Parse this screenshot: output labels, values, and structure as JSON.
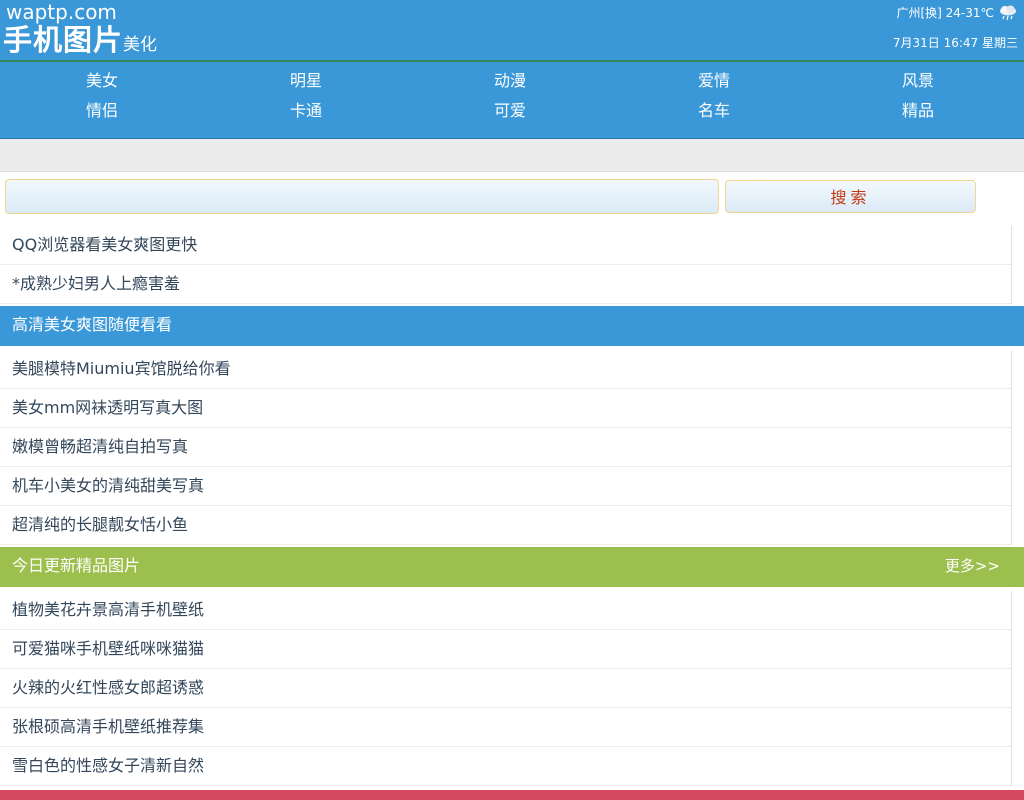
{
  "header": {
    "domain": "waptp.com",
    "title": "手机图片",
    "subtitle": "美化",
    "weather": "广州[换] 24-31℃",
    "weather_icon": "cloud-rain-icon",
    "datetime": "7月31日 16:47 星期三"
  },
  "nav": {
    "items": [
      {
        "label": "美女"
      },
      {
        "label": "明星"
      },
      {
        "label": "动漫"
      },
      {
        "label": "爱情"
      },
      {
        "label": "风景"
      },
      {
        "label": "情侣"
      },
      {
        "label": "卡通"
      },
      {
        "label": "可爱"
      },
      {
        "label": "名车"
      },
      {
        "label": "精品"
      }
    ]
  },
  "search": {
    "value": "",
    "button_label": "搜索"
  },
  "top_links": [
    {
      "text": "QQ浏览器看美女爽图更快"
    },
    {
      "text": "*成熟少妇男人上瘾害羞"
    }
  ],
  "section1": {
    "title": "高清美女爽图随便看看",
    "items": [
      {
        "text": "美腿模特Miumiu宾馆脱给你看"
      },
      {
        "text": "美女mm网袜透明写真大图"
      },
      {
        "text": "嫩模曾畅超清纯自拍写真"
      },
      {
        "text": "机车小美女的清纯甜美写真"
      },
      {
        "text": "超清纯的长腿靓女恬小鱼"
      }
    ]
  },
  "section2": {
    "title": "今日更新精品图片",
    "more": "更多>>",
    "items": [
      {
        "text": "植物美花卉景高清手机壁纸"
      },
      {
        "text": "可爱猫咪手机壁纸咪咪猫猫"
      },
      {
        "text": "火辣的火红性感女郎超诱惑"
      },
      {
        "text": "张根硕高清手机壁纸推荐集"
      },
      {
        "text": "雪白色的性感女子清新自然"
      }
    ]
  },
  "colors": {
    "header_blue": "#3a98d8",
    "section_green": "#9dbf4e",
    "footer_red": "#d5495f",
    "search_text": "#c23a13"
  }
}
